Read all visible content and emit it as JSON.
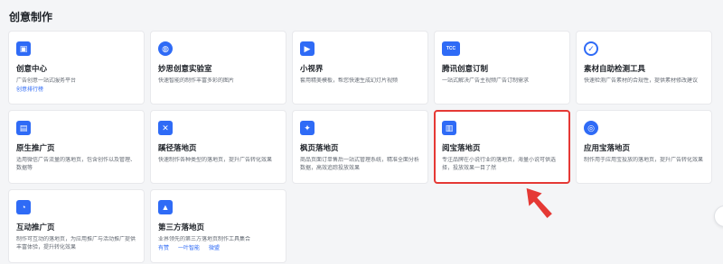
{
  "section": {
    "title": "创意制作"
  },
  "cards": [
    {
      "title": "创意中心",
      "desc": "广告创意一站式服务平台",
      "links": [
        "创意排行榜"
      ],
      "icon": "image-icon",
      "glyph": "▣"
    },
    {
      "title": "妙思创意实验室",
      "desc": "快速智能的制作丰富多彩的图片",
      "links": [],
      "icon": "lab-icon",
      "glyph": "◍"
    },
    {
      "title": "小视界",
      "desc": "套用精美模板，帮您快速生成幻灯片视频",
      "links": [],
      "icon": "video-icon",
      "glyph": "▶"
    },
    {
      "title": "腾讯创意订制",
      "desc": "一站式解决广告主视频广告订制需求",
      "links": [],
      "icon": "tcc-icon",
      "glyph": "TCC"
    },
    {
      "title": "素材自助检测工具",
      "desc": "快速检测广告素材的合规性，提供素材修改建议",
      "links": [],
      "icon": "check-icon",
      "glyph": "✓"
    },
    {
      "title": "原生推广页",
      "desc": "适用微信广告流量的落地页，包含创作以及管理、数据等",
      "links": [],
      "icon": "page-icon",
      "glyph": "▤"
    },
    {
      "title": "蹊径落地页",
      "desc": "快速制作各种类型的落地页，提升广告转化效果",
      "links": [],
      "icon": "tools-icon",
      "glyph": "✕"
    },
    {
      "title": "枫页落地页",
      "desc": "商品页面订单售后一站式管理系统，精准全面分析数据，高效追踪投放效果",
      "links": [],
      "icon": "maple-icon",
      "glyph": "✦"
    },
    {
      "title": "阅宝落地页",
      "desc": "专注品牌在小说行业的落地页，海量小说可供选择，投放效果一目了然",
      "links": [],
      "icon": "book-icon",
      "glyph": "▥",
      "highlight": true
    },
    {
      "title": "应用宝落地页",
      "desc": "制作用于应用宝投放的落地页，提升广告转化效果",
      "links": [],
      "icon": "app-store-icon",
      "glyph": "◎"
    },
    {
      "title": "互动推广页",
      "desc": "制作可互动的落地页，为应用推广与活动推广提供丰富体验，提升转化效果",
      "links": [],
      "icon": "interactive-icon",
      "glyph": "◔"
    },
    {
      "title": "第三方落地页",
      "desc": "业界领先的第三方落地页制作工具集合",
      "links": [
        "有赞",
        "一叶智能",
        "微盟"
      ],
      "icon": "gallery-icon",
      "glyph": "▲"
    }
  ],
  "colors": {
    "accent": "#2f6bf6",
    "highlight": "#e53935",
    "background": "#f4f5f7"
  }
}
